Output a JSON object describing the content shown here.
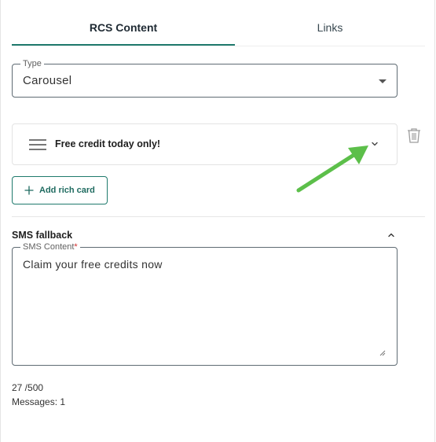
{
  "tabs": [
    {
      "label": "RCS Content",
      "active": true
    },
    {
      "label": "Links",
      "active": false
    }
  ],
  "type_field": {
    "label": "Type",
    "value": "Carousel"
  },
  "rich_card": {
    "title": "Free credit today only!",
    "expanded": false
  },
  "add_rich_card_label": "Add rich card",
  "sms_fallback": {
    "heading": "SMS fallback",
    "field_label": "SMS Content",
    "required_mark": "*",
    "value": "Claim your free credits now",
    "char_count": "27 /500",
    "messages": "Messages: 1"
  },
  "colors": {
    "accent": "#1f7a6d",
    "annotation_arrow": "#5cbf4a",
    "required": "#d32f2f"
  },
  "icons": [
    "drag-handle-icon",
    "chevron-down-icon",
    "trash-icon",
    "plus-icon",
    "chevron-up-icon"
  ]
}
